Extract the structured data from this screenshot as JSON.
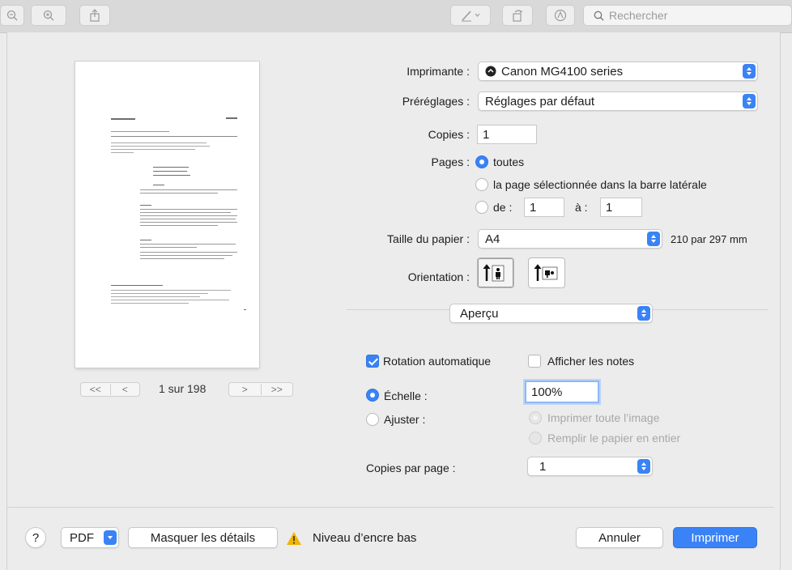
{
  "toolbar": {
    "search_placeholder": "Rechercher",
    "zoom_out_icon": "zoom-out-icon",
    "zoom_in_icon": "zoom-in-icon",
    "share_icon": "share-icon",
    "markup_icon": "pen-icon",
    "rotate_icon": "rotate-icon",
    "annotate_icon": "markup-circle-icon"
  },
  "preview": {
    "page_counter": "1 sur 198",
    "first_label": "<<",
    "prev_label": "<",
    "next_label": ">",
    "last_label": ">>"
  },
  "printer": {
    "label": "Imprimante :",
    "value": "Canon MG4100 series"
  },
  "presets": {
    "label": "Préréglages :",
    "value": "Réglages par défaut"
  },
  "copies": {
    "label": "Copies :",
    "value": "1"
  },
  "pages": {
    "label": "Pages :",
    "all": "toutes",
    "selected": "la page sélectionnée dans la barre latérale",
    "from": "de :",
    "from_value": "1",
    "to": "à :",
    "to_value": "1"
  },
  "paper": {
    "label": "Taille du papier :",
    "value": "A4",
    "size": "210 par 297 mm"
  },
  "orientation": {
    "label": "Orientation :"
  },
  "section": {
    "value": "Aperçu"
  },
  "options": {
    "auto_rotate": "Rotation automatique",
    "show_notes": "Afficher les notes",
    "scale": "Échelle :",
    "scale_value": "100%",
    "fit": "Ajuster :",
    "print_entire": "Imprimer toute l’image",
    "fill_paper": "Remplir le papier en entier",
    "copies_per_page_label": "Copies par page :",
    "copies_per_page_value": "1"
  },
  "footer": {
    "help": "?",
    "pdf": "PDF",
    "hide_details": "Masquer les détails",
    "ink_warning": "Niveau d’encre bas",
    "cancel": "Annuler",
    "print": "Imprimer"
  },
  "colors": {
    "accent": "#3a83f6",
    "warning": "#f2b500"
  }
}
